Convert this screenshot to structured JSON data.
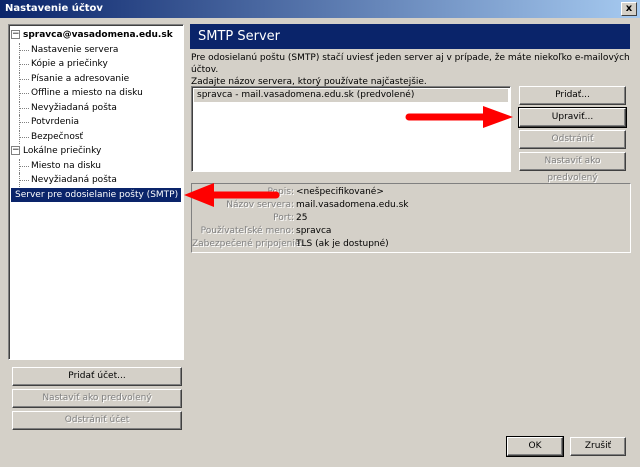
{
  "window": {
    "title": "Nastavenie účtov",
    "close_label": "x"
  },
  "tree": {
    "account1": {
      "label": "spravca@vasadomena.edu.sk",
      "expander": "−",
      "children": [
        "Nastavenie servera",
        "Kópie a priečinky",
        "Písanie a adresovanie",
        "Offline a miesto na disku",
        "Nevyžiadaná pošta",
        "Potvrdenia",
        "Bezpečnosť"
      ]
    },
    "account2": {
      "label": "Lokálne priečinky",
      "expander": "−",
      "children": [
        "Miesto na disku",
        "Nevyžiadaná pošta"
      ]
    },
    "smtp_item": "Server pre odosielanie pošty (SMTP)"
  },
  "left_buttons": {
    "add_account": "Pridať účet...",
    "set_default": "Nastaviť ako predvolený",
    "remove_account": "Odstrániť účet"
  },
  "panel": {
    "title": "SMTP Server",
    "description_line1": "Pre odosielanú poštu (SMTP) stačí uviesť jeden server aj v prípade, že máte niekoľko e-mailových účtov.",
    "description_line2": "Zadajte názov servera, ktorý používate najčastejšie.",
    "server_list": [
      "spravca - mail.vasadomena.edu.sk (predvolené)"
    ],
    "buttons": {
      "add": "Pridať...",
      "edit": "Upraviť...",
      "remove": "Odstrániť",
      "set_default": "Nastaviť ako predvolený"
    },
    "details": [
      {
        "label": "Popis:",
        "value": "<nešpecifikované>"
      },
      {
        "label": "Názov servera:",
        "value": "mail.vasadomena.edu.sk"
      },
      {
        "label": "Port:",
        "value": "25"
      },
      {
        "label": "Používateľské meno:",
        "value": "spravca"
      },
      {
        "label": "Zabezpečené pripojenie:",
        "value": "TLS (ak je dostupné)"
      }
    ]
  },
  "dialog_buttons": {
    "ok": "OK",
    "cancel": "Zrušiť"
  },
  "colors": {
    "arrow": "#ff0000",
    "selection": "#0a246a",
    "header": "#0a246a"
  }
}
